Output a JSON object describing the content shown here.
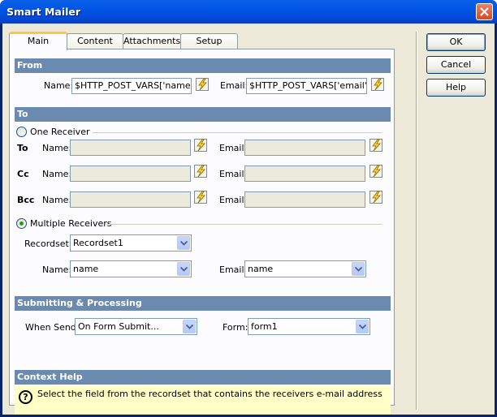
{
  "window": {
    "title": "Smart Mailer"
  },
  "tabs": [
    "Main",
    "Content",
    "Attachments",
    "Setup"
  ],
  "buttons": {
    "ok": "OK",
    "cancel": "Cancel",
    "help": "Help"
  },
  "from": {
    "header": "From",
    "name_label": "Name:",
    "name_value": "$HTTP_POST_VARS['name']",
    "email_label": "Email:",
    "email_value": "$HTTP_POST_VARS['email']"
  },
  "to": {
    "header": "To",
    "one_receiver": "One Receiver",
    "rows": [
      {
        "label": "To",
        "name_label": "Name:",
        "email_label": "Email:"
      },
      {
        "label": "Cc",
        "name_label": "Name:",
        "email_label": "Email:"
      },
      {
        "label": "Bcc",
        "name_label": "Name:",
        "email_label": "Email:"
      }
    ],
    "multiple_receivers": "Multiple Receivers",
    "recordset_label": "Recordset:",
    "recordset_value": "Recordset1",
    "name_label": "Name:",
    "name_value": "name",
    "email_label": "Email:",
    "email_value": "name"
  },
  "submitting": {
    "header": "Submitting & Processing",
    "when_send_label": "When Send:",
    "when_send_value": "On Form Submit...",
    "form_label": "Form:",
    "form_value": "form1"
  },
  "context_help": {
    "header": "Context Help",
    "text": "Select the field from the recordset that contains the receivers e-mail address"
  },
  "colors": {
    "section_header": "#6b8aaf",
    "help_bg": "#ffffc8",
    "titlebar": "#0055e5",
    "active_tab_accent": "#ffc83c"
  }
}
